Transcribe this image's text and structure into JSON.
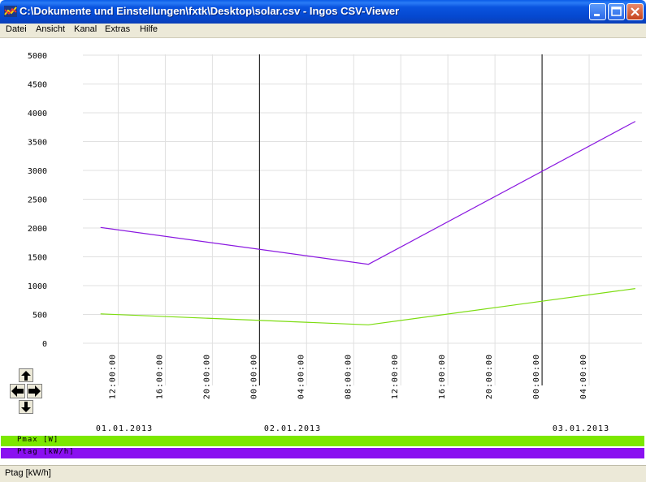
{
  "window": {
    "title": "C:\\Dokumente und Einstellungen\\fxtk\\Desktop\\solar.csv - Ingos CSV-Viewer"
  },
  "menu": [
    "Datei",
    "Ansicht",
    "Kanal",
    "Extras",
    "Hilfe"
  ],
  "chart_data": {
    "type": "line",
    "x_unit": "datetime",
    "ylim": [
      0,
      5000
    ],
    "yticks": [
      "5000",
      "4500",
      "4000",
      "3500",
      "3000",
      "2500",
      "2000",
      "1500",
      "1000",
      "500",
      "0"
    ],
    "xtick_labels": [
      "12:00:00",
      "16:00:00",
      "20:00:00",
      "00:00:00",
      "04:00:00",
      "08:00:00",
      "12:00:00",
      "16:00:00",
      "20:00:00",
      "00:00:00",
      "04:00:00"
    ],
    "date_labels": [
      "01.01.2013",
      "02.01.2013",
      "03.01.2013"
    ],
    "grid": true,
    "series": [
      {
        "name": "Pmax [W]",
        "color": "#7cdc10",
        "points": [
          [
            "2013-01-01 10:30",
            510
          ],
          [
            "2013-01-02 09:15",
            320
          ],
          [
            "2013-01-03 07:55",
            950
          ]
        ]
      },
      {
        "name": "Ptag [kW/h]",
        "color": "#8a18e0",
        "points": [
          [
            "2013-01-01 10:30",
            2010
          ],
          [
            "2013-01-02 09:15",
            1370
          ],
          [
            "2013-01-03 07:55",
            3850
          ]
        ]
      }
    ]
  },
  "legend": [
    {
      "label": "Pmax [W]",
      "color": "#7ce800"
    },
    {
      "label": "Ptag [kW/h]",
      "color": "#8a10f0"
    }
  ],
  "status": "Ptag [kW/h]"
}
